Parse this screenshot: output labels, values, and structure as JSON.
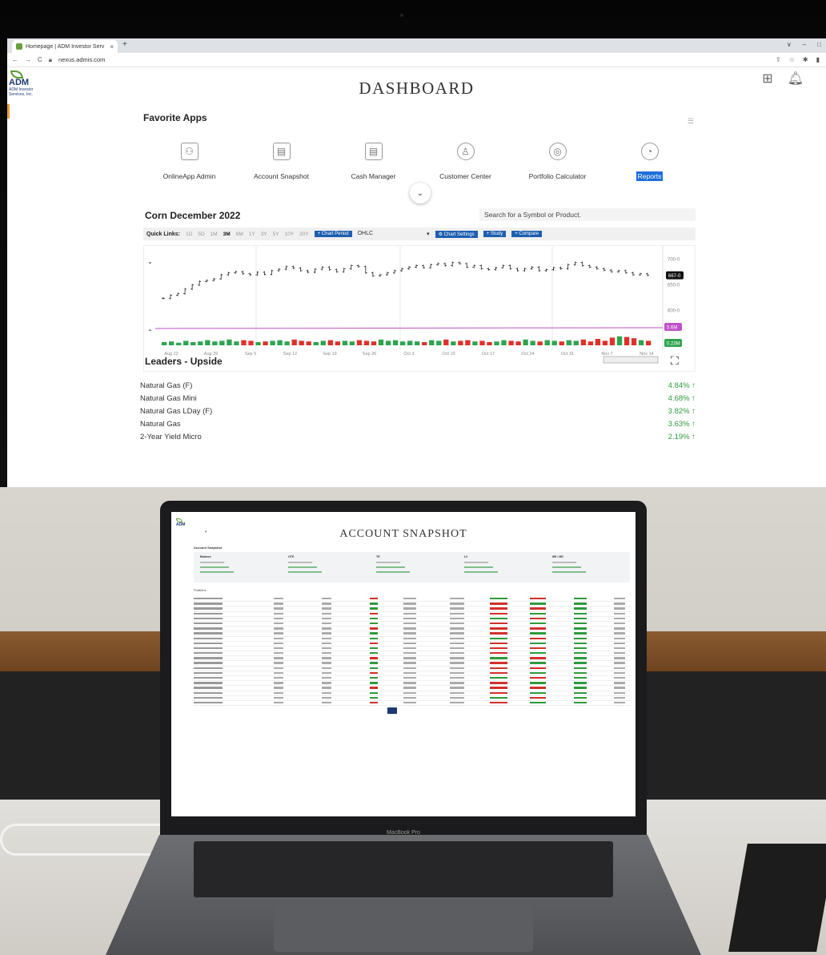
{
  "browser": {
    "tab_title": "Homepage | ADM Investor Serv",
    "tab_close": "×",
    "new_tab": "+",
    "url": "nexus.admis.com",
    "win_min": "–",
    "win_max": "□",
    "win_expand": "∨"
  },
  "brand": {
    "logo_text": "ADM",
    "logo_sub": "ADM Investor Services, Inc.",
    "accent_color": "#1d3a73",
    "leaf_color": "#5a9a32"
  },
  "header": {
    "title": "DASHBOARD"
  },
  "favorite_apps": {
    "title": "Favorite Apps",
    "items": [
      {
        "label": "OnlineApp Admin",
        "icon": "people-icon",
        "glyph": "⚇"
      },
      {
        "label": "Account Snapshot",
        "icon": "snapshot-icon",
        "glyph": "▤"
      },
      {
        "label": "Cash Manager",
        "icon": "cash-icon",
        "glyph": "▤"
      },
      {
        "label": "Customer Center",
        "icon": "customer-icon",
        "glyph": "♙"
      },
      {
        "label": "Portfolio Calculator",
        "icon": "calculator-icon",
        "glyph": "◎"
      },
      {
        "label": "Reports",
        "icon": "pie-chart-icon",
        "glyph": "◔",
        "selected": true
      }
    ]
  },
  "chart_card": {
    "title": "Corn December 2022",
    "search_placeholder": "Search for a Symbol or Product.",
    "quick_links_label": "Quick Links:",
    "periods": [
      "1D",
      "5D",
      "1M",
      "3M",
      "6M",
      "1Y",
      "3Y",
      "5Y",
      "10Y",
      "20Y"
    ],
    "active_period": "3M",
    "chart_period_btn": "+ Chart Period",
    "chart_type": "OHLC",
    "chart_settings_btn": "⚙ Chart Settings",
    "study_btn": "+ Study",
    "compare_btn": "+ Compare"
  },
  "chart_data": {
    "type": "ohlc",
    "title": "Corn December 2022",
    "x_ticks": [
      "Aug 22",
      "Aug 29",
      "Sep 5",
      "Sep 12",
      "Sep 19",
      "Sep 26",
      "Oct 3",
      "Oct 10",
      "Oct 17",
      "Oct 24",
      "Oct 31",
      "Nov 7",
      "Nov 14"
    ],
    "y_ticks": [
      "700-0",
      "650-0",
      "600-0"
    ],
    "ylim": [
      580,
      712
    ],
    "last_price_label": "667-0",
    "secondary_labels": [
      "5.6M",
      "0.23M"
    ],
    "close": [
      622,
      628,
      631,
      640,
      648,
      655,
      657,
      660,
      668,
      672,
      674,
      670,
      668,
      673,
      669,
      676,
      679,
      684,
      681,
      676,
      673,
      679,
      683,
      678,
      674,
      680,
      686,
      684,
      672,
      666,
      668,
      672,
      676,
      680,
      683,
      686,
      682,
      688,
      690,
      686,
      692,
      690,
      683,
      686,
      680,
      678,
      682,
      686,
      680,
      676,
      680,
      683,
      676,
      678,
      682,
      680,
      688,
      692,
      686,
      683,
      680,
      677,
      674,
      676,
      672,
      668,
      670,
      667
    ],
    "volume": [
      0.5,
      0.6,
      0.4,
      0.7,
      0.5,
      0.6,
      0.8,
      0.6,
      0.7,
      0.9,
      0.6,
      0.8,
      0.7,
      0.5,
      0.6,
      0.7,
      0.8,
      0.6,
      0.9,
      0.7,
      0.6,
      0.5,
      0.7,
      0.8,
      0.6,
      0.7,
      0.6,
      0.8,
      0.7,
      0.6,
      0.9,
      0.7,
      0.8,
      0.6,
      0.7,
      0.6,
      0.5,
      0.8,
      0.7,
      0.9,
      0.6,
      0.7,
      0.8,
      0.6,
      0.7,
      0.5,
      0.6,
      0.8,
      0.7,
      0.6,
      0.9,
      0.7,
      0.6,
      0.8,
      0.7,
      0.6,
      0.8,
      0.7,
      0.9,
      0.6,
      1.0,
      0.7,
      1.2,
      1.4,
      1.3,
      1.1,
      0.8,
      0.7
    ],
    "up_color": "#2ea44f",
    "down_color": "#e0302a",
    "line_color": "#c050c8"
  },
  "leaders": {
    "title": "Leaders - Upside",
    "rows": [
      {
        "name": "Natural Gas (F)",
        "pct": "4.84% ↑"
      },
      {
        "name": "Natural Gas Mini",
        "pct": "4.68% ↑"
      },
      {
        "name": "Natural Gas LDay (F)",
        "pct": "3.82% ↑"
      },
      {
        "name": "Natural Gas",
        "pct": "3.63% ↑"
      },
      {
        "name": "2-Year Yield Micro",
        "pct": "2.19% ↑"
      }
    ]
  },
  "laptop": {
    "title": "ACCOUNT SNAPSHOT",
    "brand_text": "ADM",
    "section": "Account Snapshot",
    "balances": [
      {
        "label": "Balance"
      },
      {
        "label": "OTE"
      },
      {
        "label": "TE"
      },
      {
        "label": "LV"
      },
      {
        "label": "ME / MD"
      }
    ],
    "positions_tab": "Positions",
    "model_name": "MacBook Pro"
  }
}
